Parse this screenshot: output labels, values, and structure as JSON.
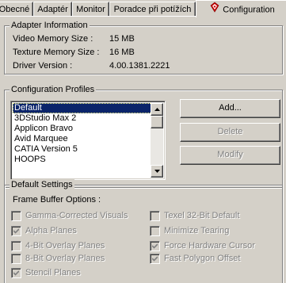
{
  "tabs": [
    {
      "label": "Obecné",
      "active": false
    },
    {
      "label": "Adaptér",
      "active": false
    },
    {
      "label": "Monitor",
      "active": false
    },
    {
      "label": "Poradce při potížích",
      "active": false
    },
    {
      "label": "Configuration",
      "active": true,
      "icon": "nvidia-logo-icon"
    }
  ],
  "adapter_info": {
    "title": "Adapter Information",
    "rows": [
      {
        "label": "Video Memory Size :",
        "value": "15 MB"
      },
      {
        "label": "Texture Memory Size :",
        "value": "16 MB"
      },
      {
        "label": "Driver Version :",
        "value": "4.00.1381.2221"
      }
    ]
  },
  "profiles": {
    "title": "Configuration Profiles",
    "items": [
      "Default",
      "3DStudio Max 2",
      "Applicon Bravo",
      "Avid Marquee",
      "CATIA Version 5",
      "HOOPS"
    ],
    "selected": "Default",
    "add_label": "Add...",
    "delete_label": "Delete",
    "modify_label": "Modify"
  },
  "default_settings": {
    "title": "Default Settings",
    "framebuffer_label": "Frame Buffer Options :",
    "left_options": [
      {
        "label": "Gamma-Corrected Visuals",
        "checked": false
      },
      {
        "label": "Alpha Planes",
        "checked": true
      },
      {
        "label": "4-Bit Overlay Planes",
        "checked": false
      },
      {
        "label": "8-Bit Overlay Planes",
        "checked": false
      },
      {
        "label": "Stencil Planes",
        "checked": true
      }
    ],
    "right_options": [
      {
        "label": "Texel 32-Bit Default",
        "checked": false
      },
      {
        "label": "Minimize Tearing",
        "checked": false
      },
      {
        "label": "Force Hardware Cursor",
        "checked": true
      },
      {
        "label": "Fast Polygon Offset",
        "checked": true
      }
    ]
  },
  "colors": {
    "face": "#d4d0c8",
    "selection": "#0a246a",
    "disabled_text": "#808080",
    "logo_red": "#cc0000"
  }
}
